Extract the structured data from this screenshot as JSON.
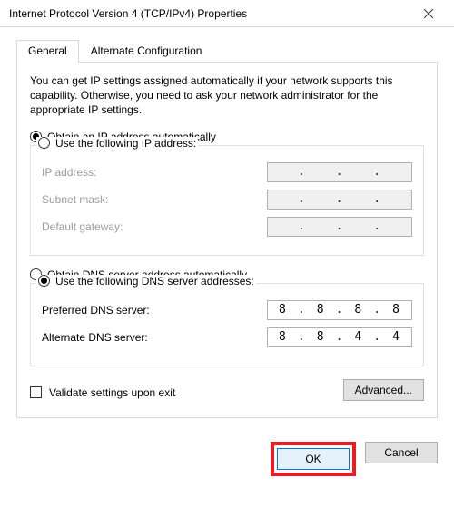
{
  "window": {
    "title": "Internet Protocol Version 4 (TCP/IPv4) Properties"
  },
  "tabs": {
    "general": "General",
    "alt": "Alternate Configuration"
  },
  "intro": "You can get IP settings assigned automatically if your network supports this capability. Otherwise, you need to ask your network administrator for the appropriate IP settings.",
  "ip": {
    "auto_label": "Obtain an IP address automatically",
    "manual_label": "Use the following IP address:",
    "fields": {
      "ip_label": "IP address:",
      "subnet_label": "Subnet mask:",
      "gateway_label": "Default gateway:"
    }
  },
  "dns": {
    "auto_label": "Obtain DNS server address automatically",
    "manual_label": "Use the following DNS server addresses:",
    "preferred_label": "Preferred DNS server:",
    "alternate_label": "Alternate DNS server:",
    "preferred": {
      "o1": "8",
      "o2": "8",
      "o3": "8",
      "o4": "8"
    },
    "alternate": {
      "o1": "8",
      "o2": "8",
      "o3": "4",
      "o4": "4"
    }
  },
  "validate_label": "Validate settings upon exit",
  "buttons": {
    "advanced": "Advanced...",
    "ok": "OK",
    "cancel": "Cancel"
  }
}
